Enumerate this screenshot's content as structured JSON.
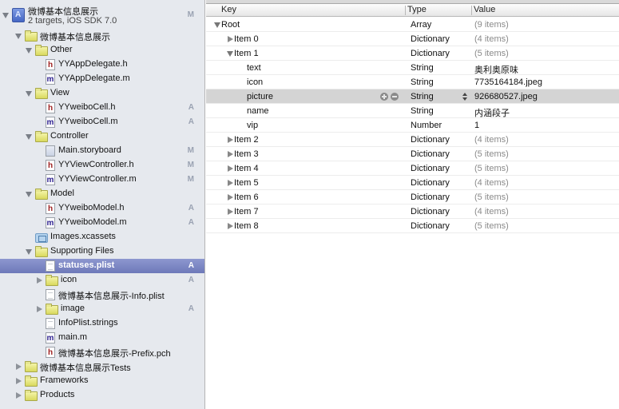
{
  "navigator": {
    "project": {
      "name": "微博基本信息展示",
      "subtitle": "2 targets, iOS SDK 7.0",
      "badge": "M"
    },
    "items": [
      {
        "label": "微博基本信息展示",
        "type": "folder",
        "depth": 1,
        "disclosure": "open",
        "badge": ""
      },
      {
        "label": "Other",
        "type": "folder",
        "depth": 2,
        "disclosure": "open",
        "badge": ""
      },
      {
        "label": "YYAppDelegate.h",
        "type": "h",
        "depth": 3,
        "disclosure": "",
        "badge": ""
      },
      {
        "label": "YYAppDelegate.m",
        "type": "m",
        "depth": 3,
        "disclosure": "",
        "badge": ""
      },
      {
        "label": "View",
        "type": "folder",
        "depth": 2,
        "disclosure": "open",
        "badge": ""
      },
      {
        "label": "YYweiboCell.h",
        "type": "h",
        "depth": 3,
        "disclosure": "",
        "badge": "A"
      },
      {
        "label": "YYweiboCell.m",
        "type": "m",
        "depth": 3,
        "disclosure": "",
        "badge": "A"
      },
      {
        "label": "Controller",
        "type": "folder",
        "depth": 2,
        "disclosure": "open",
        "badge": ""
      },
      {
        "label": "Main.storyboard",
        "type": "storyboard",
        "depth": 3,
        "disclosure": "",
        "badge": "M"
      },
      {
        "label": "YYViewController.h",
        "type": "h",
        "depth": 3,
        "disclosure": "",
        "badge": "M"
      },
      {
        "label": "YYViewController.m",
        "type": "m",
        "depth": 3,
        "disclosure": "",
        "badge": "M"
      },
      {
        "label": "Model",
        "type": "folder",
        "depth": 2,
        "disclosure": "open",
        "badge": ""
      },
      {
        "label": "YYweiboModel.h",
        "type": "h",
        "depth": 3,
        "disclosure": "",
        "badge": "A"
      },
      {
        "label": "YYweiboModel.m",
        "type": "m",
        "depth": 3,
        "disclosure": "",
        "badge": "A"
      },
      {
        "label": "Images.xcassets",
        "type": "assets",
        "depth": 2,
        "disclosure": "",
        "badge": ""
      },
      {
        "label": "Supporting Files",
        "type": "folder",
        "depth": 2,
        "disclosure": "open",
        "badge": ""
      },
      {
        "label": "statuses.plist",
        "type": "plain",
        "depth": 3,
        "disclosure": "",
        "badge": "A",
        "selected": true
      },
      {
        "label": "icon",
        "type": "folder",
        "depth": 3,
        "disclosure": "closed",
        "badge": "A"
      },
      {
        "label": "微博基本信息展示-Info.plist",
        "type": "plain",
        "depth": 3,
        "disclosure": "",
        "badge": ""
      },
      {
        "label": "image",
        "type": "folder",
        "depth": 3,
        "disclosure": "closed",
        "badge": "A"
      },
      {
        "label": "InfoPlist.strings",
        "type": "plain",
        "depth": 3,
        "disclosure": "",
        "badge": ""
      },
      {
        "label": "main.m",
        "type": "m",
        "depth": 3,
        "disclosure": "",
        "badge": ""
      },
      {
        "label": "微博基本信息展示-Prefix.pch",
        "type": "h",
        "depth": 3,
        "disclosure": "",
        "badge": ""
      },
      {
        "label": "微博基本信息展示Tests",
        "type": "folder",
        "depth": 1,
        "disclosure": "closed",
        "badge": ""
      },
      {
        "label": "Frameworks",
        "type": "folder",
        "depth": 1,
        "disclosure": "closed",
        "badge": ""
      },
      {
        "label": "Products",
        "type": "folder",
        "depth": 1,
        "disclosure": "closed",
        "badge": ""
      }
    ]
  },
  "plist": {
    "columns": {
      "key": "Key",
      "type": "Type",
      "value": "Value"
    },
    "rows": [
      {
        "key": "Root",
        "type": "Array",
        "value": "(9 items)",
        "depth": 0,
        "disclosure": "open",
        "dim": true
      },
      {
        "key": "Item 0",
        "type": "Dictionary",
        "value": "(4 items)",
        "depth": 1,
        "disclosure": "closed",
        "dim": true
      },
      {
        "key": "Item 1",
        "type": "Dictionary",
        "value": "(5 items)",
        "depth": 1,
        "disclosure": "open",
        "dim": true
      },
      {
        "key": "text",
        "type": "String",
        "value": "奥利奥原味",
        "depth": 2,
        "disclosure": "",
        "dim": false
      },
      {
        "key": "icon",
        "type": "String",
        "value": "7735164184.jpeg",
        "depth": 2,
        "disclosure": "",
        "dim": false
      },
      {
        "key": "picture",
        "type": "String",
        "value": "926680527.jpeg",
        "depth": 2,
        "disclosure": "",
        "dim": false,
        "selected": true
      },
      {
        "key": "name",
        "type": "String",
        "value": "内涵段子",
        "depth": 2,
        "disclosure": "",
        "dim": false
      },
      {
        "key": "vip",
        "type": "Number",
        "value": "1",
        "depth": 2,
        "disclosure": "",
        "dim": false
      },
      {
        "key": "Item 2",
        "type": "Dictionary",
        "value": "(4 items)",
        "depth": 1,
        "disclosure": "closed",
        "dim": true
      },
      {
        "key": "Item 3",
        "type": "Dictionary",
        "value": "(5 items)",
        "depth": 1,
        "disclosure": "closed",
        "dim": true
      },
      {
        "key": "Item 4",
        "type": "Dictionary",
        "value": "(5 items)",
        "depth": 1,
        "disclosure": "closed",
        "dim": true
      },
      {
        "key": "Item 5",
        "type": "Dictionary",
        "value": "(4 items)",
        "depth": 1,
        "disclosure": "closed",
        "dim": true
      },
      {
        "key": "Item 6",
        "type": "Dictionary",
        "value": "(5 items)",
        "depth": 1,
        "disclosure": "closed",
        "dim": true
      },
      {
        "key": "Item 7",
        "type": "Dictionary",
        "value": "(4 items)",
        "depth": 1,
        "disclosure": "closed",
        "dim": true
      },
      {
        "key": "Item 8",
        "type": "Dictionary",
        "value": "(5 items)",
        "depth": 1,
        "disclosure": "closed",
        "dim": true
      }
    ]
  }
}
